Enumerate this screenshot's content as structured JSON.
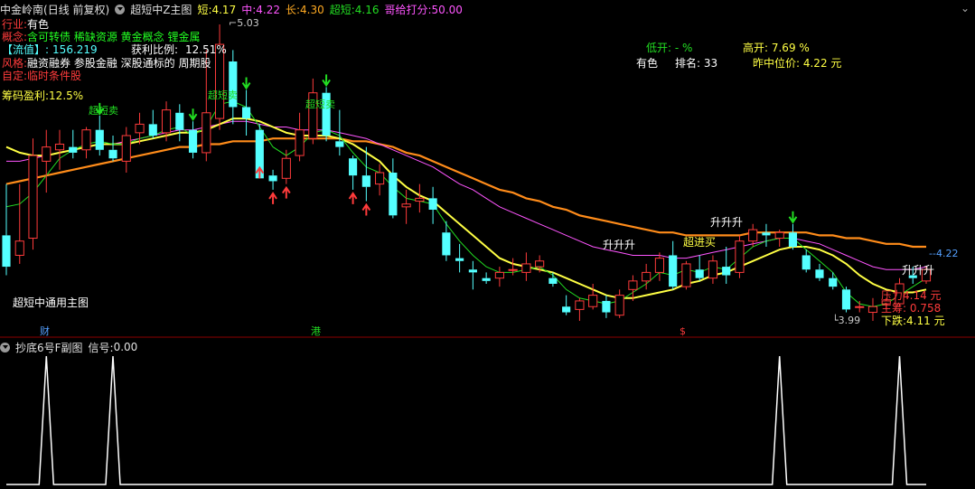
{
  "header": {
    "stock": "中金岭南",
    "period": "(日线 前复权)",
    "indicator": "超短中Z主图",
    "short_label": "短:",
    "short_value": "4.17",
    "mid_label": "中:",
    "mid_value": "4.22",
    "long_label": "长:",
    "long_value": "4.30",
    "ultra_label": "超短:",
    "ultra_value": "4.16",
    "score_label": "哥给打分:",
    "score_value": "50.00"
  },
  "info": {
    "industry_label": "行业:",
    "industry_value": "有色",
    "concept_label": "概念:",
    "concept_value": "含可转债 稀缺资源 黄金概念 锂金属",
    "float_label": "【流值】:",
    "float_value": "156.219",
    "profit_ratio_label": "获利比例:",
    "profit_ratio_value": "12.51%",
    "style_label": "风格:",
    "style_value": "融资融券 参股金融 深股通标的 周期股",
    "custom_label": "自定:",
    "custom_value": "临时条件股",
    "chip_label": "筹码盈利:",
    "chip_value": "12.5%"
  },
  "stats": {
    "low_open": "低开: - %",
    "high_open": "高开: 7.69 %",
    "sector": "有色",
    "rank": "排名: 33",
    "median_price": "昨中位价: 4.22 元"
  },
  "annotations": {
    "high_price": "5.03",
    "low_price": "3.99",
    "last_price": "4.22",
    "main_caption": "超短中通用主图",
    "pressure": "压力4.14 元",
    "main_chips": "主筹: 0.758",
    "down_support": "下跌:4.11 元",
    "event_cai": "财",
    "event_gang": "港",
    "event_s": "$",
    "sell_labels": [
      "超短卖",
      "超短卖",
      "超短卖"
    ],
    "buy_labels": [
      "升升升",
      "超进买",
      "升升升",
      "升升升"
    ]
  },
  "sub": {
    "title": "抄底6号F副图",
    "signal_label": "信号:",
    "signal_value": "0.00"
  },
  "colors": {
    "up": "#ff3b3b",
    "down": "#54ffff",
    "short_ma": "#ffff44",
    "mid_ma": "#ff55ff",
    "long_ma": "#ff8c1a",
    "ultra_ma": "#22dd22",
    "sub_line": "#ffffff"
  },
  "chart_data": [
    {
      "type": "candlestick",
      "title": "超短中Z主图",
      "price_range": [
        3.99,
        5.03
      ],
      "candles": [
        {
          "o": 4.29,
          "h": 4.47,
          "l": 4.15,
          "c": 4.18
        },
        {
          "o": 4.22,
          "h": 4.47,
          "l": 4.19,
          "c": 4.27
        },
        {
          "o": 4.28,
          "h": 4.63,
          "l": 4.24,
          "c": 4.57
        },
        {
          "o": 4.55,
          "h": 4.66,
          "l": 4.44,
          "c": 4.6
        },
        {
          "o": 4.59,
          "h": 4.66,
          "l": 4.52,
          "c": 4.61
        },
        {
          "o": 4.6,
          "h": 4.66,
          "l": 4.56,
          "c": 4.58
        },
        {
          "o": 4.59,
          "h": 4.67,
          "l": 4.56,
          "c": 4.66
        },
        {
          "o": 4.66,
          "h": 4.71,
          "l": 4.57,
          "c": 4.59
        },
        {
          "o": 4.59,
          "h": 4.64,
          "l": 4.55,
          "c": 4.56
        },
        {
          "o": 4.55,
          "h": 4.67,
          "l": 4.51,
          "c": 4.64
        },
        {
          "o": 4.65,
          "h": 4.72,
          "l": 4.61,
          "c": 4.68
        },
        {
          "o": 4.68,
          "h": 4.73,
          "l": 4.63,
          "c": 4.64
        },
        {
          "o": 4.65,
          "h": 4.76,
          "l": 4.62,
          "c": 4.73
        },
        {
          "o": 4.72,
          "h": 4.75,
          "l": 4.62,
          "c": 4.66
        },
        {
          "o": 4.66,
          "h": 4.69,
          "l": 4.56,
          "c": 4.58
        },
        {
          "o": 4.58,
          "h": 4.94,
          "l": 4.55,
          "c": 4.72
        },
        {
          "o": 4.7,
          "h": 5.03,
          "l": 4.66,
          "c": 4.96
        },
        {
          "o": 4.9,
          "h": 4.94,
          "l": 4.68,
          "c": 4.74
        },
        {
          "o": 4.74,
          "h": 4.8,
          "l": 4.64,
          "c": 4.7
        },
        {
          "o": 4.66,
          "h": 4.68,
          "l": 4.54,
          "c": 4.49
        },
        {
          "o": 4.5,
          "h": 4.52,
          "l": 4.45,
          "c": 4.48
        },
        {
          "o": 4.49,
          "h": 4.59,
          "l": 4.47,
          "c": 4.56
        },
        {
          "o": 4.57,
          "h": 4.72,
          "l": 4.55,
          "c": 4.66
        },
        {
          "o": 4.63,
          "h": 4.84,
          "l": 4.61,
          "c": 4.79
        },
        {
          "o": 4.79,
          "h": 4.81,
          "l": 4.62,
          "c": 4.64
        },
        {
          "o": 4.62,
          "h": 4.73,
          "l": 4.57,
          "c": 4.6
        },
        {
          "o": 4.56,
          "h": 4.57,
          "l": 4.45,
          "c": 4.5
        },
        {
          "o": 4.5,
          "h": 4.6,
          "l": 4.41,
          "c": 4.46
        },
        {
          "o": 4.47,
          "h": 4.54,
          "l": 4.43,
          "c": 4.51
        },
        {
          "o": 4.51,
          "h": 4.56,
          "l": 4.35,
          "c": 4.36
        },
        {
          "o": 4.39,
          "h": 4.45,
          "l": 4.33,
          "c": 4.4
        },
        {
          "o": 4.41,
          "h": 4.47,
          "l": 4.37,
          "c": 4.42
        },
        {
          "o": 4.42,
          "h": 4.46,
          "l": 4.33,
          "c": 4.38
        },
        {
          "o": 4.3,
          "h": 4.34,
          "l": 4.2,
          "c": 4.22
        },
        {
          "o": 4.21,
          "h": 4.26,
          "l": 4.16,
          "c": 4.2
        },
        {
          "o": 4.17,
          "h": 4.2,
          "l": 4.1,
          "c": 4.16
        },
        {
          "o": 4.14,
          "h": 4.16,
          "l": 4.12,
          "c": 4.13
        },
        {
          "o": 4.14,
          "h": 4.18,
          "l": 4.11,
          "c": 4.16
        },
        {
          "o": 4.17,
          "h": 4.21,
          "l": 4.15,
          "c": 4.17
        },
        {
          "o": 4.16,
          "h": 4.23,
          "l": 4.13,
          "c": 4.19
        },
        {
          "o": 4.18,
          "h": 4.22,
          "l": 4.16,
          "c": 4.2
        },
        {
          "o": 4.14,
          "h": 4.16,
          "l": 4.11,
          "c": 4.12
        },
        {
          "o": 4.04,
          "h": 4.08,
          "l": 4.01,
          "c": 4.02
        },
        {
          "o": 4.03,
          "h": 4.07,
          "l": 3.99,
          "c": 4.06
        },
        {
          "o": 4.04,
          "h": 4.12,
          "l": 4.03,
          "c": 4.08
        },
        {
          "o": 4.06,
          "h": 4.08,
          "l": 4.0,
          "c": 4.02
        },
        {
          "o": 4.01,
          "h": 4.1,
          "l": 4.0,
          "c": 4.08
        },
        {
          "o": 4.1,
          "h": 4.15,
          "l": 4.06,
          "c": 4.13
        },
        {
          "o": 4.13,
          "h": 4.19,
          "l": 4.1,
          "c": 4.16
        },
        {
          "o": 4.16,
          "h": 4.23,
          "l": 4.13,
          "c": 4.21
        },
        {
          "o": 4.22,
          "h": 4.27,
          "l": 4.1,
          "c": 4.11
        },
        {
          "o": 4.11,
          "h": 4.2,
          "l": 4.1,
          "c": 4.19
        },
        {
          "o": 4.17,
          "h": 4.22,
          "l": 4.13,
          "c": 4.14
        },
        {
          "o": 4.14,
          "h": 4.22,
          "l": 4.12,
          "c": 4.2
        },
        {
          "o": 4.18,
          "h": 4.25,
          "l": 4.12,
          "c": 4.15
        },
        {
          "o": 4.16,
          "h": 4.29,
          "l": 4.14,
          "c": 4.27
        },
        {
          "o": 4.27,
          "h": 4.33,
          "l": 4.25,
          "c": 4.31
        },
        {
          "o": 4.3,
          "h": 4.33,
          "l": 4.25,
          "c": 4.29
        },
        {
          "o": 4.28,
          "h": 4.31,
          "l": 4.25,
          "c": 4.3
        },
        {
          "o": 4.3,
          "h": 4.33,
          "l": 4.24,
          "c": 4.25
        },
        {
          "o": 4.22,
          "h": 4.24,
          "l": 4.16,
          "c": 4.17
        },
        {
          "o": 4.17,
          "h": 4.19,
          "l": 4.13,
          "c": 4.14
        },
        {
          "o": 4.14,
          "h": 4.16,
          "l": 4.1,
          "c": 4.11
        },
        {
          "o": 4.1,
          "h": 4.11,
          "l": 4.02,
          "c": 4.03
        },
        {
          "o": 4.04,
          "h": 4.06,
          "l": 4.02,
          "c": 4.04
        },
        {
          "o": 4.02,
          "h": 4.07,
          "l": 3.99,
          "c": 4.04
        },
        {
          "o": 4.05,
          "h": 4.07,
          "l": 4.03,
          "c": 4.06
        },
        {
          "o": 4.05,
          "h": 4.14,
          "l": 4.04,
          "c": 4.12
        },
        {
          "o": 4.15,
          "h": 4.18,
          "l": 4.12,
          "c": 4.14
        },
        {
          "o": 4.13,
          "h": 4.18,
          "l": 4.12,
          "c": 4.17
        }
      ],
      "ma_ultra": [
        4.39,
        4.4,
        4.44,
        4.5,
        4.56,
        4.59,
        4.61,
        4.62,
        4.61,
        4.61,
        4.63,
        4.64,
        4.66,
        4.67,
        4.64,
        4.67,
        4.75,
        4.76,
        4.74,
        4.67,
        4.6,
        4.57,
        4.6,
        4.65,
        4.66,
        4.64,
        4.58,
        4.53,
        4.51,
        4.46,
        4.42,
        4.41,
        4.4,
        4.33,
        4.27,
        4.22,
        4.18,
        4.16,
        4.16,
        4.17,
        4.18,
        4.15,
        4.1,
        4.07,
        4.06,
        4.05,
        4.06,
        4.09,
        4.12,
        4.16,
        4.15,
        4.17,
        4.16,
        4.18,
        4.17,
        4.21,
        4.25,
        4.27,
        4.28,
        4.28,
        4.24,
        4.2,
        4.16,
        4.09,
        4.05,
        4.04,
        4.05,
        4.08,
        4.11,
        4.14
      ],
      "ma_short": [
        4.6,
        4.58,
        4.57,
        4.57,
        4.58,
        4.59,
        4.6,
        4.61,
        4.61,
        4.61,
        4.62,
        4.63,
        4.64,
        4.65,
        4.65,
        4.66,
        4.68,
        4.7,
        4.7,
        4.69,
        4.67,
        4.65,
        4.64,
        4.64,
        4.64,
        4.63,
        4.61,
        4.58,
        4.55,
        4.5,
        4.46,
        4.43,
        4.41,
        4.37,
        4.33,
        4.29,
        4.25,
        4.21,
        4.19,
        4.18,
        4.17,
        4.16,
        4.14,
        4.12,
        4.1,
        4.08,
        4.07,
        4.07,
        4.08,
        4.09,
        4.1,
        4.12,
        4.13,
        4.15,
        4.16,
        4.18,
        4.2,
        4.22,
        4.24,
        4.25,
        4.25,
        4.24,
        4.22,
        4.19,
        4.15,
        4.12,
        4.1,
        4.09,
        4.09,
        4.1
      ],
      "ma_mid": [
        4.55,
        4.55,
        4.56,
        4.57,
        4.58,
        4.59,
        4.6,
        4.61,
        4.61,
        4.62,
        4.63,
        4.64,
        4.65,
        4.66,
        4.66,
        4.67,
        4.68,
        4.69,
        4.69,
        4.68,
        4.67,
        4.67,
        4.66,
        4.66,
        4.66,
        4.65,
        4.64,
        4.63,
        4.61,
        4.59,
        4.57,
        4.55,
        4.53,
        4.5,
        4.47,
        4.45,
        4.42,
        4.39,
        4.37,
        4.35,
        4.33,
        4.31,
        4.29,
        4.27,
        4.25,
        4.24,
        4.23,
        4.22,
        4.22,
        4.22,
        4.21,
        4.21,
        4.22,
        4.23,
        4.24,
        4.25,
        4.26,
        4.27,
        4.28,
        4.28,
        4.27,
        4.26,
        4.24,
        4.22,
        4.2,
        4.18,
        4.17,
        4.17,
        4.17,
        4.18
      ],
      "ma_long": [
        4.47,
        4.48,
        4.49,
        4.5,
        4.51,
        4.52,
        4.53,
        4.54,
        4.55,
        4.56,
        4.57,
        4.58,
        4.59,
        4.6,
        4.6,
        4.61,
        4.61,
        4.62,
        4.62,
        4.62,
        4.63,
        4.63,
        4.63,
        4.63,
        4.63,
        4.63,
        4.62,
        4.62,
        4.61,
        4.6,
        4.58,
        4.57,
        4.55,
        4.53,
        4.51,
        4.49,
        4.47,
        4.45,
        4.44,
        4.42,
        4.41,
        4.39,
        4.38,
        4.36,
        4.35,
        4.34,
        4.33,
        4.32,
        4.31,
        4.3,
        4.3,
        4.29,
        4.29,
        4.29,
        4.29,
        4.29,
        4.3,
        4.3,
        4.3,
        4.3,
        4.3,
        4.29,
        4.29,
        4.28,
        4.28,
        4.27,
        4.26,
        4.26,
        4.25,
        4.25
      ]
    },
    {
      "type": "line",
      "title": "抄底6号F副图",
      "ylim": [
        0,
        1
      ],
      "values": [
        0,
        0,
        0,
        1,
        0,
        0,
        0,
        0,
        1,
        0,
        0,
        0,
        0,
        0,
        0,
        0,
        0,
        0,
        0,
        0,
        0,
        0,
        0,
        0,
        0,
        0,
        0,
        0,
        0,
        0,
        0,
        0,
        0,
        0,
        0,
        0,
        0,
        0,
        0,
        0,
        0,
        0,
        0,
        0,
        0,
        0,
        0,
        0,
        0,
        0,
        0,
        0,
        0,
        0,
        0,
        0,
        0,
        0,
        1,
        0,
        0,
        0,
        0,
        0,
        0,
        0,
        0,
        1,
        0,
        0
      ]
    }
  ]
}
